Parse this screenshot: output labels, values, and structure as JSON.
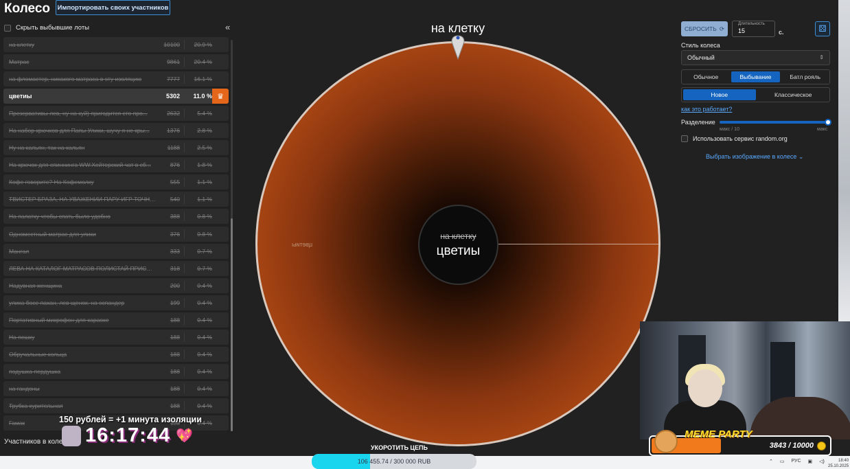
{
  "header": {
    "title": "Колесо",
    "import_button": "Импортировать своих участников"
  },
  "sidebar": {
    "hide_label": "Скрыть выбывшие лоты",
    "collapse_icon": "«",
    "items": [
      {
        "name": "на клетку",
        "amount": "10100",
        "pct": "20.9 %"
      },
      {
        "name": "Матрас",
        "amount": "9861",
        "pct": "20.4 %"
      },
      {
        "name": "на фломастер, никакого матраса в эту изоляцию",
        "amount": "7777",
        "pct": "16.1 %"
      },
      {
        "name": "цветиы",
        "amount": "5302",
        "pct": "11.0 %",
        "active": true
      },
      {
        "name": "Презервативы лев, ну на куй) пригодится сто про...",
        "amount": "2632",
        "pct": "5.4 %"
      },
      {
        "name": "На набор крючков для Папы Улики, шучу я не кры...",
        "amount": "1376",
        "pct": "2.8 %"
      },
      {
        "name": "Ну на кальян, так на кальян",
        "amount": "1188",
        "pct": "2.5 %"
      },
      {
        "name": "На крючок для спиннинга WW.Хейтерский чат в сб...",
        "amount": "876",
        "pct": "1.8 %"
      },
      {
        "name": "Кофе говорите? На Кофемолку",
        "amount": "555",
        "pct": "1.1 %"
      },
      {
        "name": "ТВИСТЕР БРАЗА, НА УВАЖЕНИИ ПАРУ ИГР ТОЧНО...",
        "amount": "540",
        "pct": "1.1 %"
      },
      {
        "name": "На палатку чтобы спать было удобно",
        "amount": "388",
        "pct": "0.8 %"
      },
      {
        "name": "Одноместный матрас для улики",
        "amount": "376",
        "pct": "0.8 %"
      },
      {
        "name": "Мангал",
        "amount": "333",
        "pct": "0.7 %"
      },
      {
        "name": "ЛЕВА НА КАТАЛОГ МАТРАСОВ ПОЛИСТАЙ ПРИСМ...",
        "amount": "318",
        "pct": "0.7 %"
      },
      {
        "name": "Надувная женщина",
        "amount": "200",
        "pct": "0.4 %"
      },
      {
        "name": "улика босс-пахан, лев щенок. на эспандер",
        "amount": "199",
        "pct": "0.4 %"
      },
      {
        "name": "Портативный микрофон для караоке",
        "amount": "188",
        "pct": "0.4 %"
      },
      {
        "name": "На пешку",
        "amount": "188",
        "pct": "0.4 %"
      },
      {
        "name": "Обручальные кольца",
        "amount": "188",
        "pct": "0.4 %"
      },
      {
        "name": "подушка-пердушка",
        "amount": "188",
        "pct": "0.4 %"
      },
      {
        "name": "на гандоны",
        "amount": "188",
        "pct": "0.4 %"
      },
      {
        "name": "Трубка курительная",
        "amount": "188",
        "pct": "0.4 %"
      },
      {
        "name": "Гамак",
        "amount": "188",
        "pct": "0.4 %"
      }
    ],
    "participants_label": "Участников в коле..."
  },
  "wheel": {
    "top_label": "на клетку",
    "center_prev": "на клетку",
    "center_winner": "цветиы",
    "mirror_label": "цветиы",
    "colors": {
      "sector": "#bb4f15",
      "border": "#d9c8bd"
    }
  },
  "controls": {
    "reset_label": "СБРОСИТЬ",
    "duration_label": "Длительность",
    "duration_value": "15",
    "seconds": "с.",
    "style_label": "Стиль колеса",
    "style_value": "Обычный",
    "modes": [
      "Обычное",
      "Выбывание",
      "Батл рояль"
    ],
    "active_mode": 1,
    "variants": [
      "Новое",
      "Классическое"
    ],
    "active_variant": 0,
    "how_link": "как это работает?",
    "split_label": "Разделение",
    "split_min": "макс / 10",
    "split_max": "макс",
    "split_level": 1.0,
    "randomorg_label": "Использовать сервис random.org",
    "pick_image": "Выбрать изображение в колесе"
  },
  "overlay": {
    "promo": "150 рублей = +1 минута изоляции",
    "timer": "16:17:44",
    "meme_title": "MEME PARTY",
    "meme_count": "3843 / 10000",
    "meme_level": 0.3843,
    "goal_label": "УКОРОТИТЬ ЦЕПЬ",
    "goal_text": "106 455.74 / 300 000 RUB",
    "goal_level": 0.3549
  },
  "taskbar": {
    "lang": "РУС",
    "time": "18:40",
    "date": "25.10.2025"
  }
}
